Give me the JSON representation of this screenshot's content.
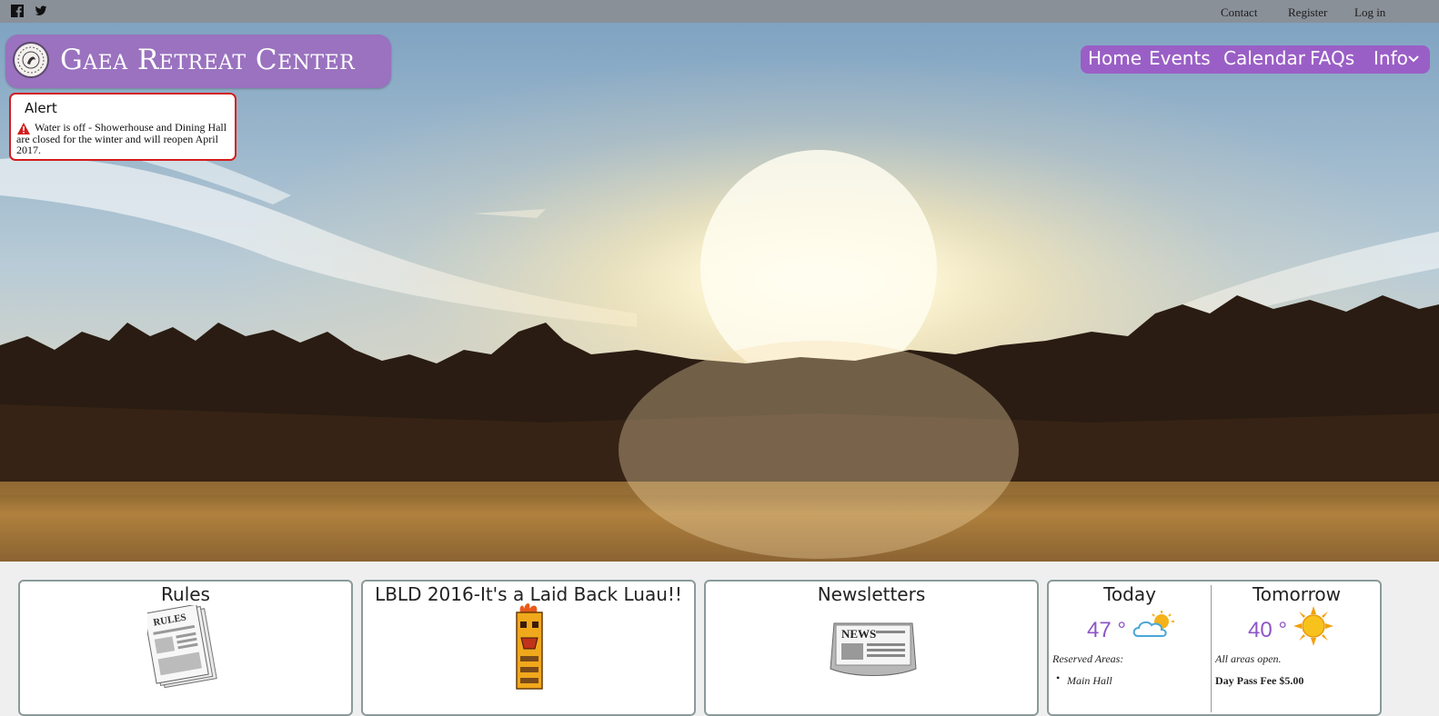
{
  "topbar": {
    "social": [
      {
        "name": "facebook-icon"
      },
      {
        "name": "twitter-icon"
      }
    ],
    "links": [
      "Contact",
      "Register",
      "Log in"
    ]
  },
  "logo": {
    "title": "Gaea Retreat Center"
  },
  "nav": {
    "items": [
      "Home",
      "Events",
      "Calendar",
      "FAQs",
      "Info"
    ],
    "dropdown_icon": "chevron-down-icon",
    "color": "#9a5fc6"
  },
  "alert": {
    "title": "Alert",
    "icon": "warning-icon",
    "text": "Water is off - Showerhouse and Dining Hall are closed for the winter and will reopen April 2017.",
    "border_color": "#d41c1c"
  },
  "cards": [
    {
      "title": "Rules",
      "image": "rules-newspaper-image"
    },
    {
      "title": "LBLD 2016-It's a Laid Back Luau!!",
      "image": "tiki-image"
    },
    {
      "title": "Newsletters",
      "image": "news-image"
    }
  ],
  "weather": {
    "today": {
      "title": "Today",
      "temp": "47 °",
      "icon": "partly-cloudy-icon",
      "note": "Reserved Areas:",
      "list": [
        "Main Hall"
      ]
    },
    "tomorrow": {
      "title": "Tomorrow",
      "temp": "40 °",
      "icon": "sun-icon",
      "note": "All areas open.",
      "fee": "Day Pass Fee $5.00"
    },
    "temp_color": "#8e56c5"
  }
}
